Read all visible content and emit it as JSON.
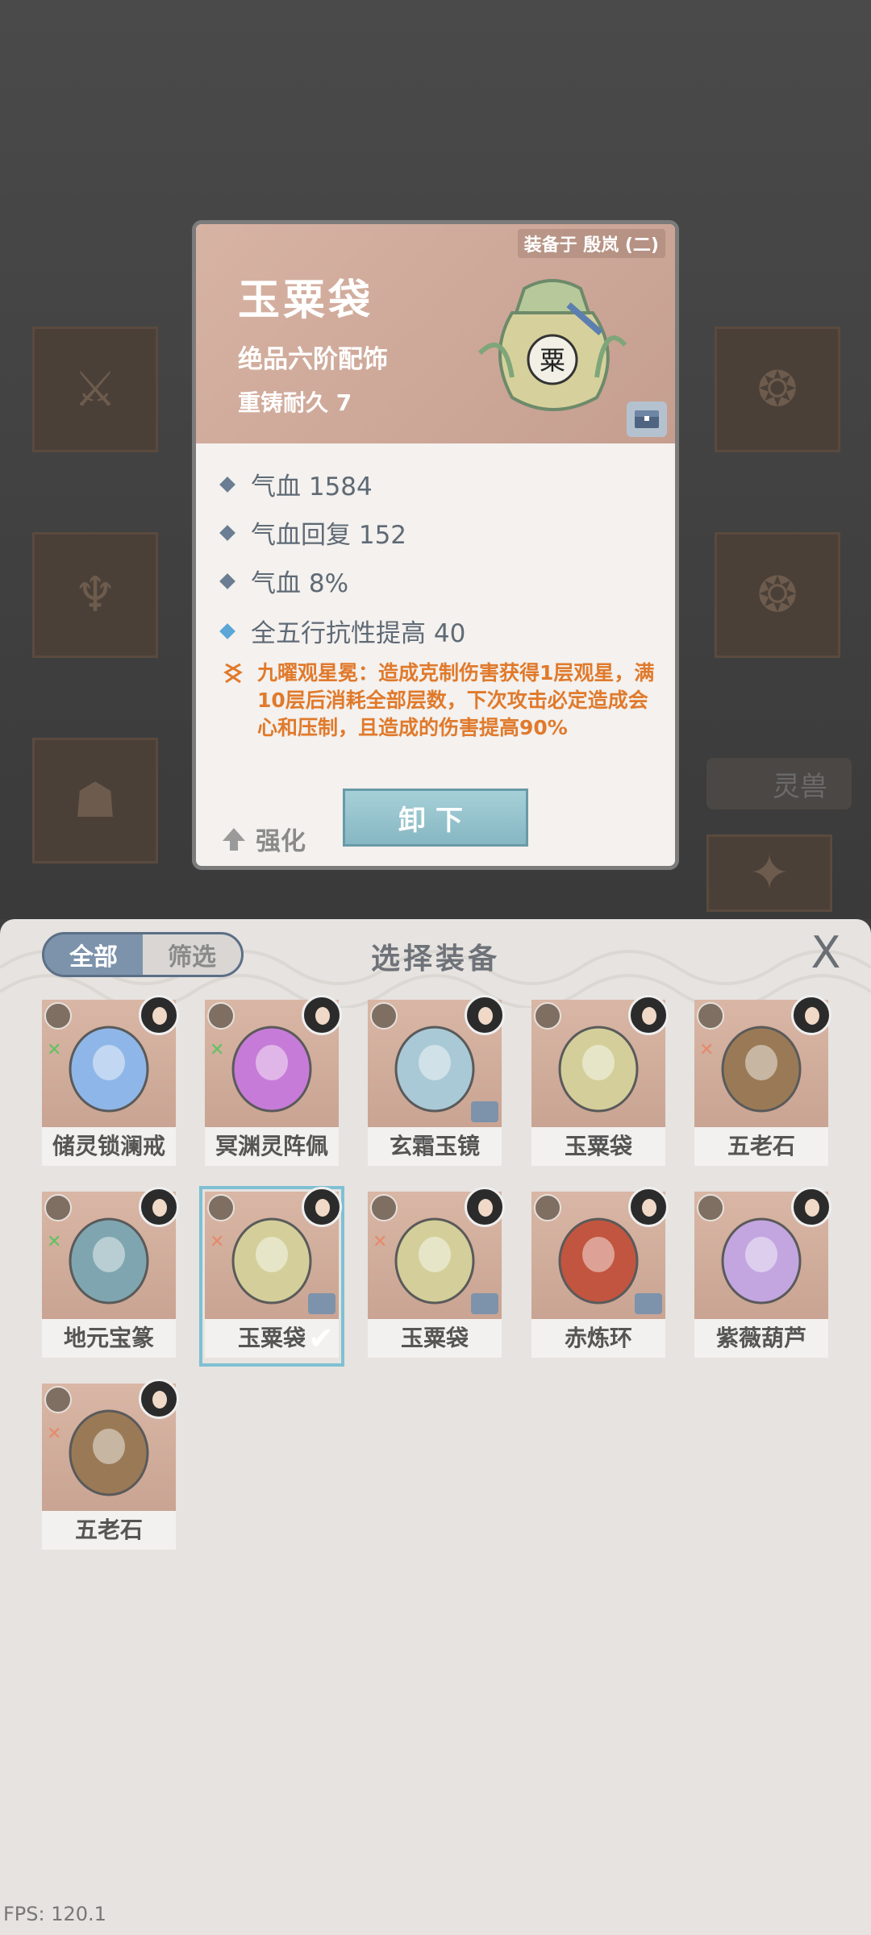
{
  "detail": {
    "equipped_by": "装备于 殷岚 (二)",
    "name": "玉粟袋",
    "grade": "绝品六阶配饰",
    "durability": "重铸耐久 7",
    "stats": [
      "气血 1584",
      "气血回复 152",
      "气血 8%",
      "全五行抗性提高 40"
    ],
    "special": "九曜观星冕：造成克制伤害获得1层观星，满10层后消耗全部层数，下次攻击必定造成会心和压制，且造成的伤害提高90%",
    "strengthen_label": "强化",
    "unequip_label": "卸下"
  },
  "background": {
    "lingshou_label": "灵兽"
  },
  "panel": {
    "tab_all": "全部",
    "tab_filter": "筛选",
    "title": "选择装备",
    "close": "X"
  },
  "items": [
    {
      "name": "储灵锁澜戒",
      "color": "#8fb6e8",
      "mark": "green"
    },
    {
      "name": "冥渊灵阵佩",
      "color": "#c77bd8",
      "mark": "green"
    },
    {
      "name": "玄霜玉镜",
      "color": "#a9c9d6",
      "mark": "none",
      "chest": true
    },
    {
      "name": "玉粟袋",
      "color": "#d4cf9a",
      "mark": "none"
    },
    {
      "name": "五老石",
      "color": "#9a7a56",
      "mark": "red"
    },
    {
      "name": "地元宝篆",
      "color": "#7fa6b0",
      "mark": "green"
    },
    {
      "name": "玉粟袋",
      "color": "#d4cf9a",
      "mark": "red",
      "chest": true,
      "selected": true
    },
    {
      "name": "玉粟袋",
      "color": "#d4cf9a",
      "mark": "red",
      "chest": true
    },
    {
      "name": "赤炼环",
      "color": "#c2553f",
      "mark": "none",
      "chest": true
    },
    {
      "name": "紫薇葫芦",
      "color": "#c3a6e0",
      "mark": "none"
    },
    {
      "name": "五老石",
      "color": "#9a7a56",
      "mark": "red"
    }
  ],
  "fps": "FPS: 120.1"
}
